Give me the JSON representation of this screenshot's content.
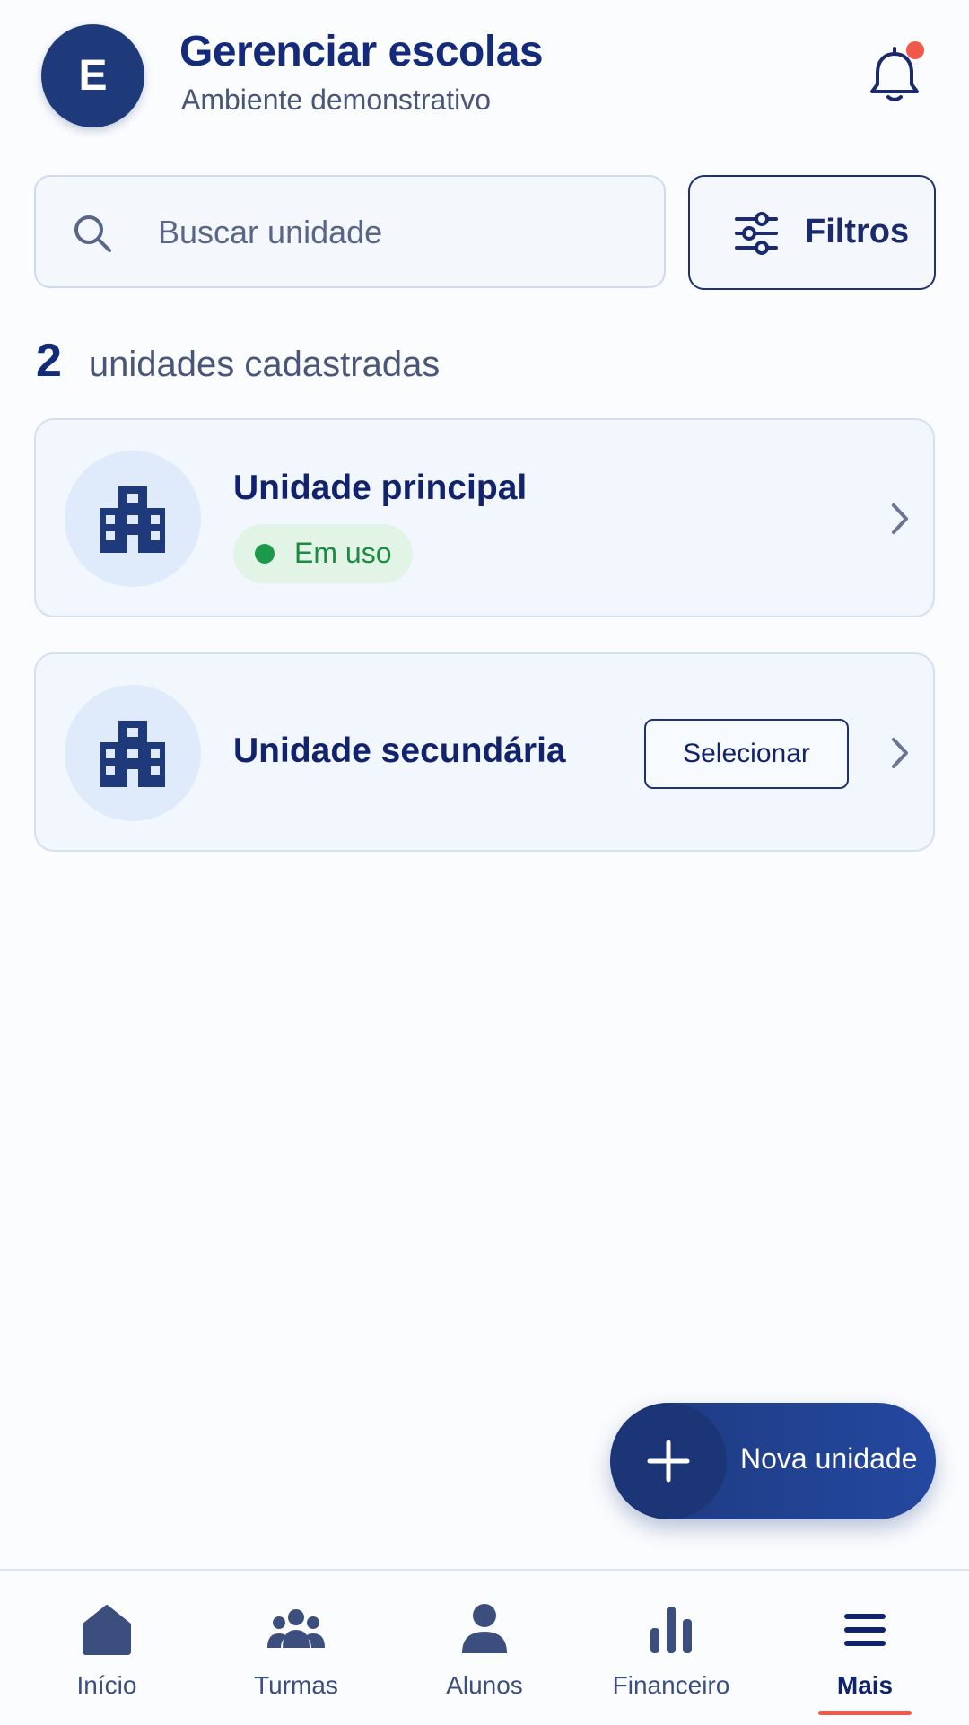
{
  "header": {
    "avatar_letter": "E",
    "title": "Gerenciar escolas",
    "subtitle": "Ambiente demonstrativo"
  },
  "search": {
    "placeholder": "Buscar unidade",
    "value": ""
  },
  "filters": {
    "label": "Filtros"
  },
  "summary": {
    "count": "2",
    "label": "unidades cadastradas"
  },
  "units": [
    {
      "name": "Unidade principal",
      "status": "Em uso"
    },
    {
      "name": "Unidade secundária",
      "action": "Selecionar"
    }
  ],
  "fab": {
    "label": "Nova unidade"
  },
  "nav": {
    "items": [
      {
        "label": "Início",
        "icon": "home-icon"
      },
      {
        "label": "Turmas",
        "icon": "group-icon"
      },
      {
        "label": "Alunos",
        "icon": "person-icon"
      },
      {
        "label": "Financeiro",
        "icon": "bar-chart-icon"
      },
      {
        "label": "Mais",
        "icon": "menu-icon"
      }
    ],
    "active_index": 4
  },
  "colors": {
    "primary": "#1f3a7a",
    "accent_red": "#f0584a",
    "status_green": "#1c9a4a",
    "badge_bg": "#e2f4e6",
    "card_bg": "#f2f7fd"
  }
}
